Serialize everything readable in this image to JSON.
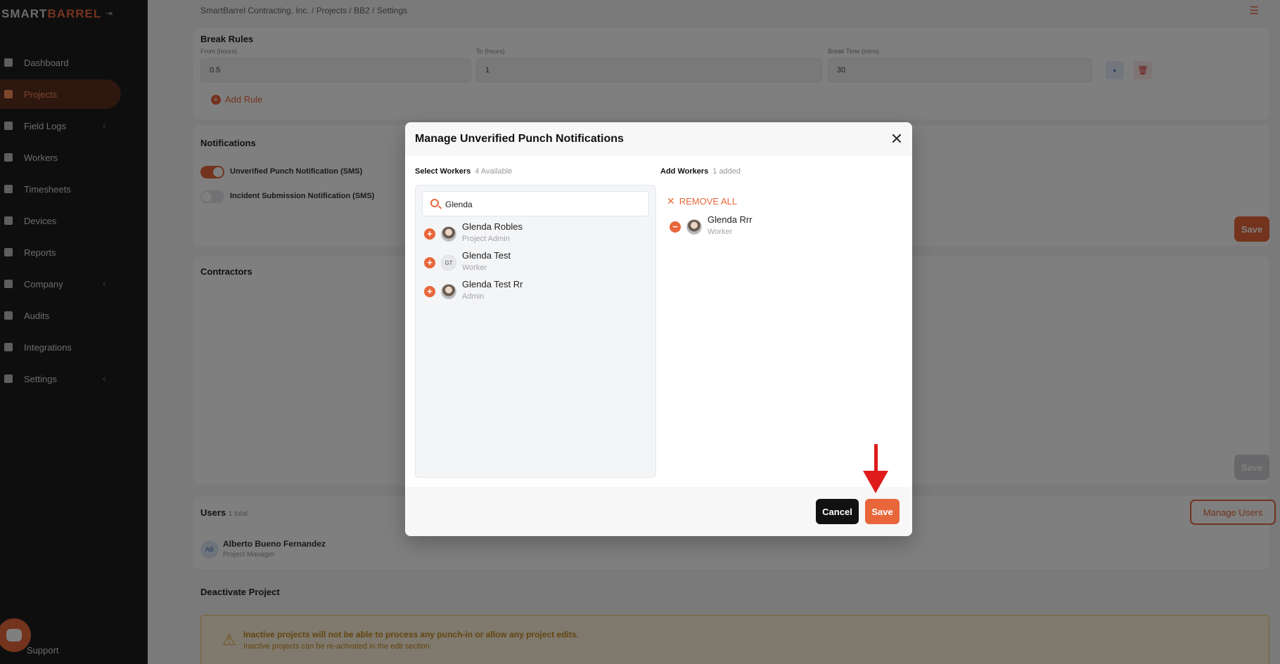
{
  "sidebar": {
    "logo_part1": "SMART",
    "logo_part2": "BARREL",
    "items": [
      {
        "label": "Dashboard"
      },
      {
        "label": "Projects"
      },
      {
        "label": "Field Logs"
      },
      {
        "label": "Workers"
      },
      {
        "label": "Timesheets"
      },
      {
        "label": "Devices"
      },
      {
        "label": "Reports"
      },
      {
        "label": "Company"
      },
      {
        "label": "Audits"
      },
      {
        "label": "Integrations"
      },
      {
        "label": "Settings"
      }
    ],
    "support_label": "Support"
  },
  "header": {
    "breadcrumb": "SmartBarrel Contracting, Inc.  /  Projects  /  BB2  /  Settings"
  },
  "break_rules": {
    "title": "Break Rules",
    "from_label": "From (hours)",
    "to_label": "To (hours)",
    "break_label": "Break Time (mins)",
    "from_value": "0.5",
    "to_value": "1",
    "break_value": "30",
    "add_rule": "Add Rule"
  },
  "notifications": {
    "title": "Notifications",
    "toggle1": "Unverified Punch Notification (SMS)",
    "toggle2": "Incident Submission Notification (SMS)",
    "save": "Save"
  },
  "contractors": {
    "title": "Contractors",
    "save": "Save"
  },
  "users": {
    "title": "Users",
    "count": "1 total",
    "manage": "Manage Users",
    "user_name": "Alberto Bueno Fernandez",
    "user_role": "Project Manager",
    "user_initials": "AB"
  },
  "deactivate": {
    "title": "Deactivate Project",
    "warning_title": "Inactive projects will not be able to process any punch-in or allow any project edits.",
    "warning_sub": "Inactive projects can be re-activated in the edit section"
  },
  "modal": {
    "title": "Manage Unverified Punch Notifications",
    "select_label": "Select Workers",
    "select_count": "4 Available",
    "add_label": "Add Workers",
    "add_count": "1 added",
    "search_value": "Glenda",
    "available_workers": [
      {
        "name": "Glenda Robles",
        "role": "Project Admin"
      },
      {
        "name": "Glenda Test",
        "role": "Worker",
        "initials": "GT"
      },
      {
        "name": "Glenda Test Rr",
        "role": "Admin"
      }
    ],
    "remove_all": "REMOVE ALL",
    "added_workers": [
      {
        "name": "Glenda Rrr",
        "role": "Worker"
      }
    ],
    "cancel": "Cancel",
    "save": "Save"
  },
  "colors": {
    "accent": "#e8663a",
    "annotation_arrow": "#e01b1b"
  }
}
